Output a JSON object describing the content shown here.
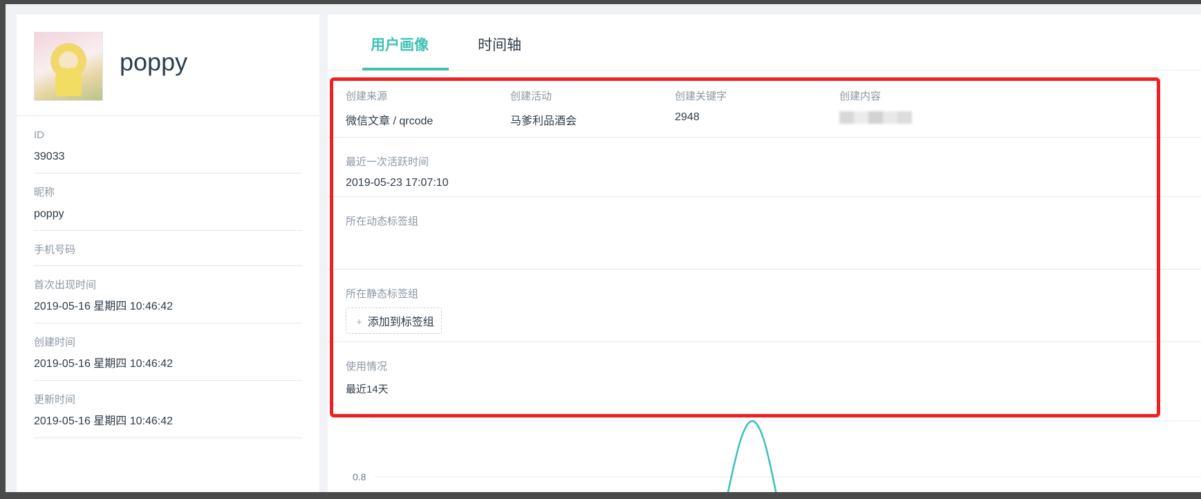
{
  "profile": {
    "username": "poppy",
    "fields": [
      {
        "label": "ID",
        "value": "39033"
      },
      {
        "label": "昵称",
        "value": "poppy"
      },
      {
        "label": "手机号码",
        "value": ""
      },
      {
        "label": "首次出现时间",
        "value": "2019-05-16 星期四 10:46:42"
      },
      {
        "label": "创建时间",
        "value": "2019-05-16 星期四 10:46:42"
      },
      {
        "label": "更新时间",
        "value": "2019-05-16 星期四 10:46:42"
      }
    ]
  },
  "tabs": [
    {
      "label": "用户画像",
      "active": true
    },
    {
      "label": "时间轴",
      "active": false
    }
  ],
  "details": {
    "source_label": "创建来源",
    "source_value": "微信文章 / qrcode",
    "activity_label": "创建活动",
    "activity_value": "马爹利品酒会",
    "keyword_label": "创建关键字",
    "keyword_value": "2948",
    "content_label": "创建内容",
    "last_active_label": "最近一次活跃时间",
    "last_active_value": "2019-05-23 17:07:10",
    "dynamic_group_label": "所在动态标签组",
    "static_group_label": "所在静态标签组",
    "add_to_group_button": "添加到标签组",
    "usage_label": "使用情况",
    "usage_value": "最近14天"
  },
  "chart_data": {
    "type": "line",
    "y_tick_labels": [
      "0.8"
    ],
    "series": [
      {
        "color": "#3cc1b3"
      }
    ]
  },
  "colors": {
    "accent": "#3cc1b3",
    "highlight": "#f02020"
  }
}
